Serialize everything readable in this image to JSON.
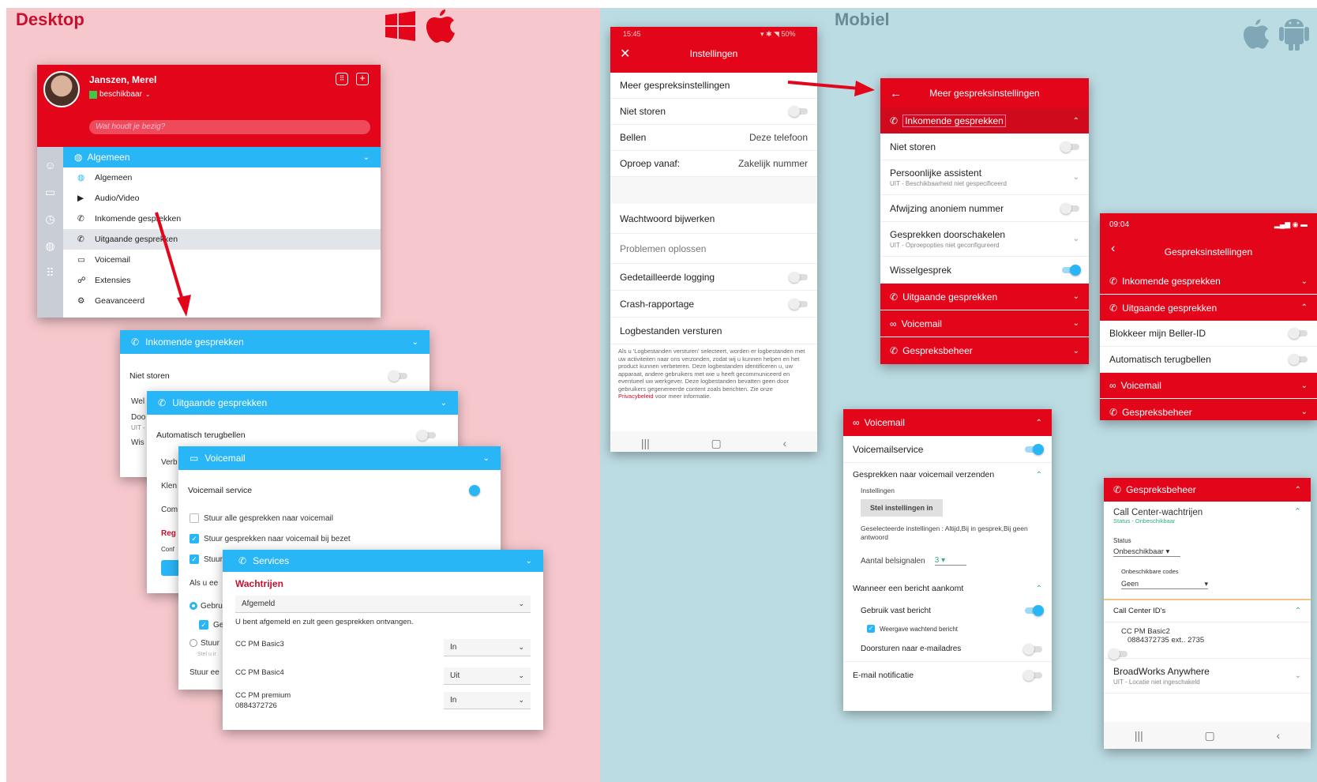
{
  "desktop": {
    "title": "Desktop",
    "platform_icons": [
      "windows-icon",
      "apple-icon"
    ]
  },
  "mobile": {
    "title": "Mobiel",
    "platform_icons": [
      "apple-icon",
      "android-icon"
    ]
  },
  "profile": {
    "name": "Janszen, Merel",
    "status": "beschikbaar",
    "status_placeholder": "Wat houdt je bezig?"
  },
  "desk_menu": {
    "header": "Algemeen",
    "items": [
      "Algemeen",
      "Audio/Video",
      "Inkomende gesprekken",
      "Uitgaande gesprekken",
      "Voicemail",
      "Extensies",
      "Geavanceerd"
    ]
  },
  "inc_panel": {
    "title": "Inkomende gesprekken",
    "niet_storen": "Niet storen",
    "peek": [
      "Wel",
      "Doo",
      "UIT -",
      "Wis"
    ]
  },
  "out_panel": {
    "title": "Uitgaande gesprekken",
    "auto": "Automatisch terugbellen",
    "peek": [
      "Verb",
      "Klen",
      "Com",
      "Reg",
      "Conf"
    ]
  },
  "vm_panel": {
    "title": "Voicemail",
    "service": "Voicemail service",
    "opt1": "Stuur alle gesprekken naar voicemail",
    "opt2": "Stuur gesprekken naar voicemail bij bezet",
    "opt3": "Stuur",
    "peek": [
      "Als u ee",
      "Gebru",
      "Gel",
      "Stuur",
      "Stel u ir",
      "Stuur ee"
    ]
  },
  "svc_panel": {
    "title": "Services",
    "section": "Wachtrijen",
    "state": "Afgemeld",
    "note": "U bent afgemeld en zult geen gesprekken ontvangen.",
    "queues": [
      {
        "name": "CC PM Basic3",
        "sub": "",
        "value": "In"
      },
      {
        "name": "CC PM Basic4",
        "sub": "",
        "value": "Uit"
      },
      {
        "name": "CC PM premium",
        "sub": "0884372726",
        "value": "In"
      }
    ]
  },
  "and_settings": {
    "status_time": "15:45",
    "status_right": "50%",
    "title": "Instellingen",
    "rows": [
      {
        "label": "Meer gespreksinstellingen",
        "value": ""
      },
      {
        "label": "Niet storen",
        "value": ""
      },
      {
        "label": "Bellen",
        "value": "Deze telefoon"
      },
      {
        "label": "Oproep vanaf:",
        "value": "Zakelijk nummer"
      }
    ],
    "rows2": [
      "Wachtwoord bijwerken",
      "Problemen oplossen",
      "Gedetailleerde logging",
      "Crash-rapportage",
      "Logbestanden versturen"
    ],
    "info": "Als u 'Logbestanden versturen' selecteert, worden er logbestanden met uw activiteiten naar ons verzonden, zodat wij u kunnen helpen en het product kunnen verbeteren. Deze logbestanden identificeren u, uw apparaat, andere gebruikers met wie u heeft gecommuniceerd en eventueel uw werkgever. Deze logbestanden bevatten geen door gebruikers gegenereerde content zoals berichten. Zie onze",
    "info_link": "Privacybeleid",
    "info_end": "voor meer informatie."
  },
  "meer": {
    "title": "Meer gespreksinstellingen",
    "inc": "Inkomende gesprekken",
    "rows": [
      {
        "label": "Niet storen",
        "sub": ""
      },
      {
        "label": "Persoonlijke assistent",
        "sub": "UIT - Beschikbaarheid niet gespecificeerd"
      },
      {
        "label": "Afwijzing anoniem nummer",
        "sub": ""
      },
      {
        "label": "Gesprekken doorschakelen",
        "sub": "UIT - Oproepopties niet geconfigureerd"
      },
      {
        "label": "Wisselgesprek",
        "sub": ""
      }
    ],
    "bars": [
      "Uitgaande gesprekken",
      "Voicemail",
      "Gespreksbeheer"
    ]
  },
  "vm_mobile": {
    "title": "Voicemail",
    "service": "Voicemailservice",
    "send": "Gesprekken naar voicemail verzenden",
    "inst": "Instellingen",
    "btn": "Stel instellingen in",
    "selected": "Geselecteerde instellingen : Altijd,Bij in gesprek,Bij geen antwoord",
    "rings_label": "Aantal belsignalen",
    "rings": "3",
    "when": "Wanneer een bericht aankomt",
    "fixed": "Gebruik vast bericht",
    "waiting": "Weergave wachtend bericht",
    "forward": "Doorsturen naar e-mailadres",
    "email": "E-mail notificatie"
  },
  "ios": {
    "time": "09:04",
    "title": "Gespreksinstellingen",
    "bars": [
      "Inkomende gesprekken",
      "Uitgaande gesprekken"
    ],
    "rows": [
      "Blokkeer mijn Beller-ID",
      "Automatisch terugbellen"
    ],
    "bars2": [
      "Voicemail",
      "Gespreksbeheer"
    ]
  },
  "gb": {
    "title": "Gespreksbeheer",
    "cc": "Call Center-wachtrijen",
    "cc_sub": "Status - Onbeschikbaar",
    "status_label": "Status",
    "status": "Onbeschikbaar",
    "codes_label": "Onbeschikbare codes",
    "codes": "Geen",
    "ids": "Call Center ID's",
    "id_name": "CC PM Basic2",
    "id_num": "0884372735 ext.. 2735",
    "bw": "BroadWorks Anywhere",
    "bw_sub": "UIT - Locatie niet ingeschakeld"
  }
}
